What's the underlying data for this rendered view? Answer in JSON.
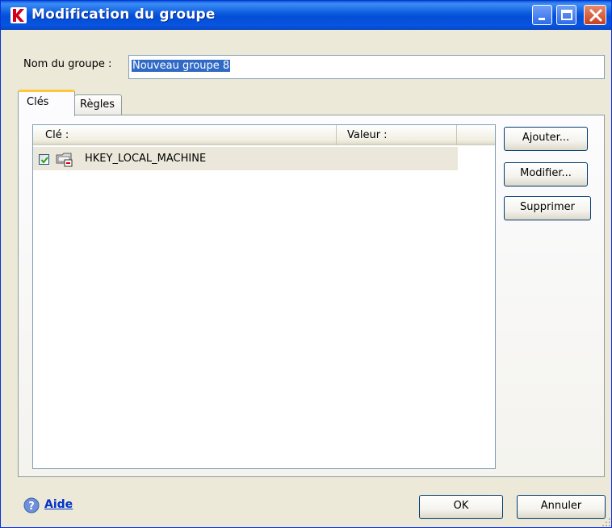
{
  "window": {
    "title": "Modification du groupe"
  },
  "titlebar_buttons": {
    "minimize": "minimize-icon",
    "maximize": "maximize-icon",
    "close": "close-icon"
  },
  "group": {
    "name_label": "Nom du groupe :",
    "name_value": "Nouveau groupe 8"
  },
  "tabs": [
    {
      "label": "Clés",
      "active": true
    },
    {
      "label": "Règles",
      "active": false
    }
  ],
  "table": {
    "columns": [
      "Clé :",
      "Valeur :"
    ],
    "rows": [
      {
        "checked": true,
        "key": "HKEY_LOCAL_MACHINE",
        "value": ""
      }
    ]
  },
  "actions": {
    "add": "Ajouter...",
    "modify": "Modifier...",
    "delete": "Supprimer"
  },
  "footer": {
    "help": "Aide",
    "ok": "OK",
    "cancel": "Annuler"
  },
  "colors": {
    "titlebar": "#0a58de",
    "selection": "#316ac5",
    "close": "#c9401f",
    "link": "#0033cc",
    "row": "#ebe8db"
  }
}
